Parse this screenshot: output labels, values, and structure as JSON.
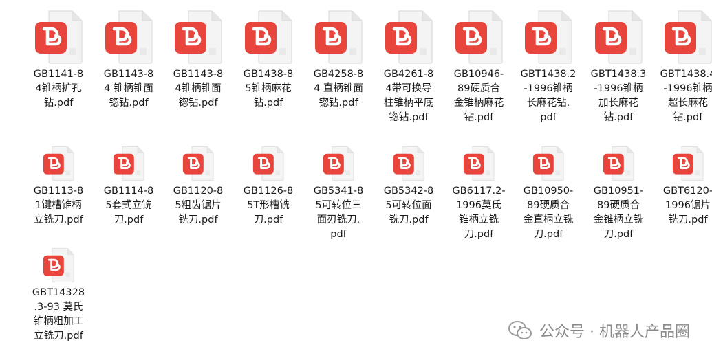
{
  "files": [
    {
      "name": "GB1141-8\n4锥柄扩孔\n钻.pdf"
    },
    {
      "name": "GB1143-8\n4 锥柄锥面\n锪钻.pdf"
    },
    {
      "name": "GB1143-8\n4锥柄锥面\n锪钻.pdf"
    },
    {
      "name": "GB1438-8\n5锥柄麻花\n钻.pdf"
    },
    {
      "name": "GB4258-8\n4 直柄锥面\n锪钻.pdf"
    },
    {
      "name": "GB4261-8\n4带可换导\n柱锥柄平底\n锪钻.pdf"
    },
    {
      "name": "GB10946-\n89硬质合\n金锥柄麻花\n钻.pdf"
    },
    {
      "name": "GBT1438.2\n-1996锥柄\n长麻花钻.\npdf"
    },
    {
      "name": "GBT1438.3\n-1996锥柄\n加长麻花\n钻.pdf"
    },
    {
      "name": "GBT1438.4\n-1996锥柄\n超长麻花\n钻.pdf"
    },
    {
      "name": "GB1113-8\n1键槽锥柄\n立铣刀.pdf"
    },
    {
      "name": "GB1114-8\n5套式立铣\n刀.pdf"
    },
    {
      "name": "GB1120-8\n5粗齿锯片\n铣刀.pdf"
    },
    {
      "name": "GB1126-8\n5T形槽铣\n刀.pdf"
    },
    {
      "name": "GB5341-8\n5可转位三\n面刃铣刀.\npdf"
    },
    {
      "name": "GB5342-8\n5可转位面\n铣刀.pdf"
    },
    {
      "name": "GB6117.2-\n1996莫氏\n锥柄立铣\n刀.pdf"
    },
    {
      "name": "GB10950-\n89硬质合\n金直柄立铣\n刀.pdf"
    },
    {
      "name": "GB10951-\n89硬质合\n金锥柄立铣\n刀.pdf"
    },
    {
      "name": "GBT6120-\n1996锯片\n铣刀.pdf"
    },
    {
      "name": "GBT14328\n.3-93 莫氏\n锥柄粗加工\n立铣刀.pdf"
    }
  ],
  "watermark": {
    "text": "公众号 · 机器人产品圈"
  },
  "colors": {
    "pdf_red": "#e8453c",
    "pdf_red_light": "#ef6b5f",
    "page_gray": "#f1f1f1"
  }
}
